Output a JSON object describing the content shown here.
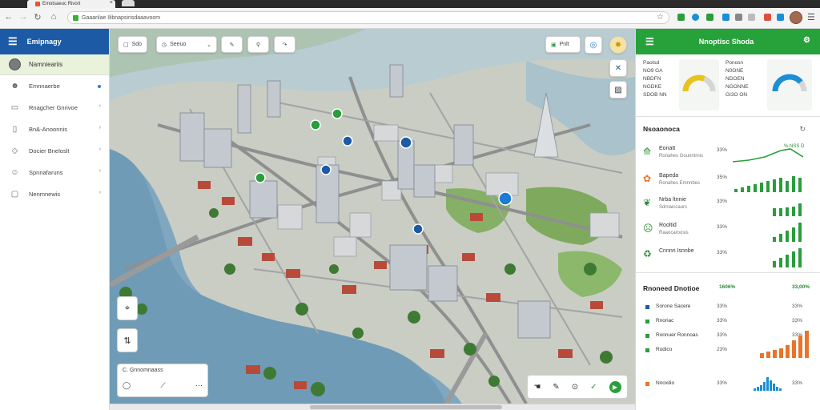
{
  "browser": {
    "tab_title": "Emotsaeuc Rivort",
    "url": "Gaaanlae Ilibnapsirisdaaavoom",
    "accent": "#3cae3c"
  },
  "sidebar": {
    "title": "Emipnagy",
    "user": "Namnieariis",
    "header_color": "#1c5aa6",
    "items": [
      {
        "label": "Emnnaerbe",
        "icon": "people-icon"
      },
      {
        "label": "Rnagcher Gnrivoe",
        "icon": "clipboard-icon"
      },
      {
        "label": "Bn&-Anoonnis",
        "icon": "document-icon"
      },
      {
        "label": "Docier Bneloslt",
        "icon": "tag-icon"
      },
      {
        "label": "Spnnafaruns",
        "icon": "person-icon"
      },
      {
        "label": "Nenmnewis",
        "icon": "lock-icon"
      }
    ]
  },
  "map_toolbar": {
    "btn1": "Sdo",
    "btn2": "Seeuo",
    "right_btn": "Pnlt",
    "legend_title": "C. Gnnomnaass"
  },
  "panel": {
    "title": "Nnoptisc Shoda",
    "header_color": "#27a13a",
    "gauges": [
      {
        "label": "Paotsd",
        "lines": [
          "NO9 GA",
          "NBDFN",
          "NGDKE",
          "SDOB NN"
        ],
        "value": 0.62,
        "color": "#e8c31a"
      },
      {
        "label": "Ponosn",
        "lines": [
          "N0ONE",
          "NDOEN",
          "NGONNE",
          "GI3O ON"
        ],
        "value": 0.78,
        "color": "#1a8fd6"
      }
    ],
    "section_title": "Nsoaonoca",
    "metrics": [
      {
        "label": "Eonatt",
        "sub": "Ronahes  Gounntrnis",
        "pct": "33%",
        "note": "% NSS D",
        "icon": "chart-up-icon"
      },
      {
        "label": "Bapeda",
        "sub": "Ronahes  Emnnbes",
        "pct": "35%",
        "icon": "palette-icon"
      },
      {
        "label": "Nrba ltnnie",
        "sub": "Sdrnaiccaurs",
        "pct": "33%",
        "icon": "leaf-icon"
      },
      {
        "label": "Rooltid",
        "sub": "Raaocaroosis",
        "pct": "33%",
        "icon": "head-icon"
      },
      {
        "label": "Cnnnn Isnnbe",
        "sub": "",
        "pct": "33%",
        "icon": "recycle-icon"
      }
    ],
    "summary": {
      "title": "Rnoneed Dnotioe",
      "col2": "1606%",
      "col3": "33,00%",
      "rows": [
        {
          "label": "Sorone Sacere",
          "pct": "33%",
          "pct2": "33%",
          "color": "#1c5aa6"
        },
        {
          "label": "Rnoriac",
          "pct": "33%",
          "pct2": "33%",
          "color": "#2a9d3c"
        },
        {
          "label": "Ronnuer Ronnoas",
          "pct": "33%",
          "pct2": "33%",
          "color": "#2a9d3c"
        },
        {
          "label": "Rodico",
          "pct": "23%",
          "pct2": "33%",
          "color": "#2a9d3c"
        },
        {
          "label": "Nnoxilio",
          "pct": "33%",
          "pct2": "33%",
          "color": "#e8742a"
        }
      ]
    }
  }
}
